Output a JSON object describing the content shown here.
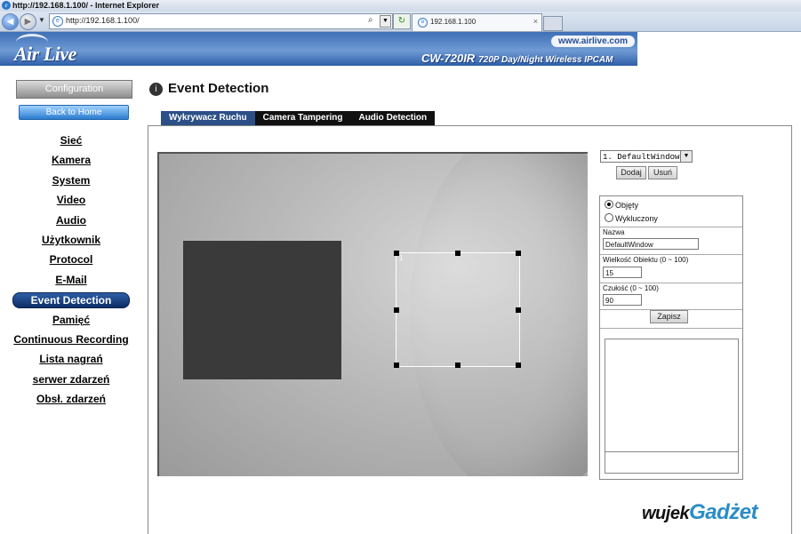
{
  "browser": {
    "window_title": "http://192.168.1.100/ - Internet Explorer",
    "address": "http://192.168.1.100/",
    "tab_title": "192.168.1.100",
    "tab_close": "×"
  },
  "header": {
    "logo_text": "Air Live",
    "site_url": "www.airlive.com",
    "model": "CW-720IR",
    "model_sub": "720P Day/Night Wireless IPCAM"
  },
  "sidebar": {
    "config_label": "Configuration",
    "home_label": "Back to Home",
    "items": [
      {
        "label": "Sieć"
      },
      {
        "label": "Kamera"
      },
      {
        "label": "System"
      },
      {
        "label": "Video"
      },
      {
        "label": "Audio"
      },
      {
        "label": "Użytkownik"
      },
      {
        "label": "Protocol"
      },
      {
        "label": "E-Mail"
      },
      {
        "label": "Event Detection",
        "active": true
      },
      {
        "label": "Pamięć"
      },
      {
        "label": "Continuous Recording"
      },
      {
        "label": "Lista nagrań"
      },
      {
        "label": "serwer zdarzeń"
      },
      {
        "label": "Obsł. zdarzeń"
      }
    ]
  },
  "main": {
    "title": "Event Detection",
    "tabs": [
      "Wykrywacz Ruchu",
      "Camera Tampering",
      "Audio Detection"
    ],
    "active_tab": 0
  },
  "detection": {
    "window_label": "1",
    "window_select": "1. DefaultWindow",
    "add_label": "Dodaj",
    "remove_label": "Usuń",
    "include_label": "Objęty",
    "exclude_label": "Wykluczony",
    "included": true,
    "name_label": "Nazwa",
    "name_value": "DefaultWindow",
    "size_label": "Wielkość Obiektu   (0 ~ 100)",
    "size_value": "15",
    "sens_label": "Czułość   (0 ~ 100)",
    "sens_value": "90",
    "save_label": "Zapisz"
  },
  "watermark": {
    "prefix": "wujek",
    "suffix": "Gadżet"
  },
  "colors": {
    "banner": "#4a78bf",
    "active_menu": "#1c3f7a",
    "tab_bar": "#111111",
    "active_tab": "#2b4f86"
  }
}
